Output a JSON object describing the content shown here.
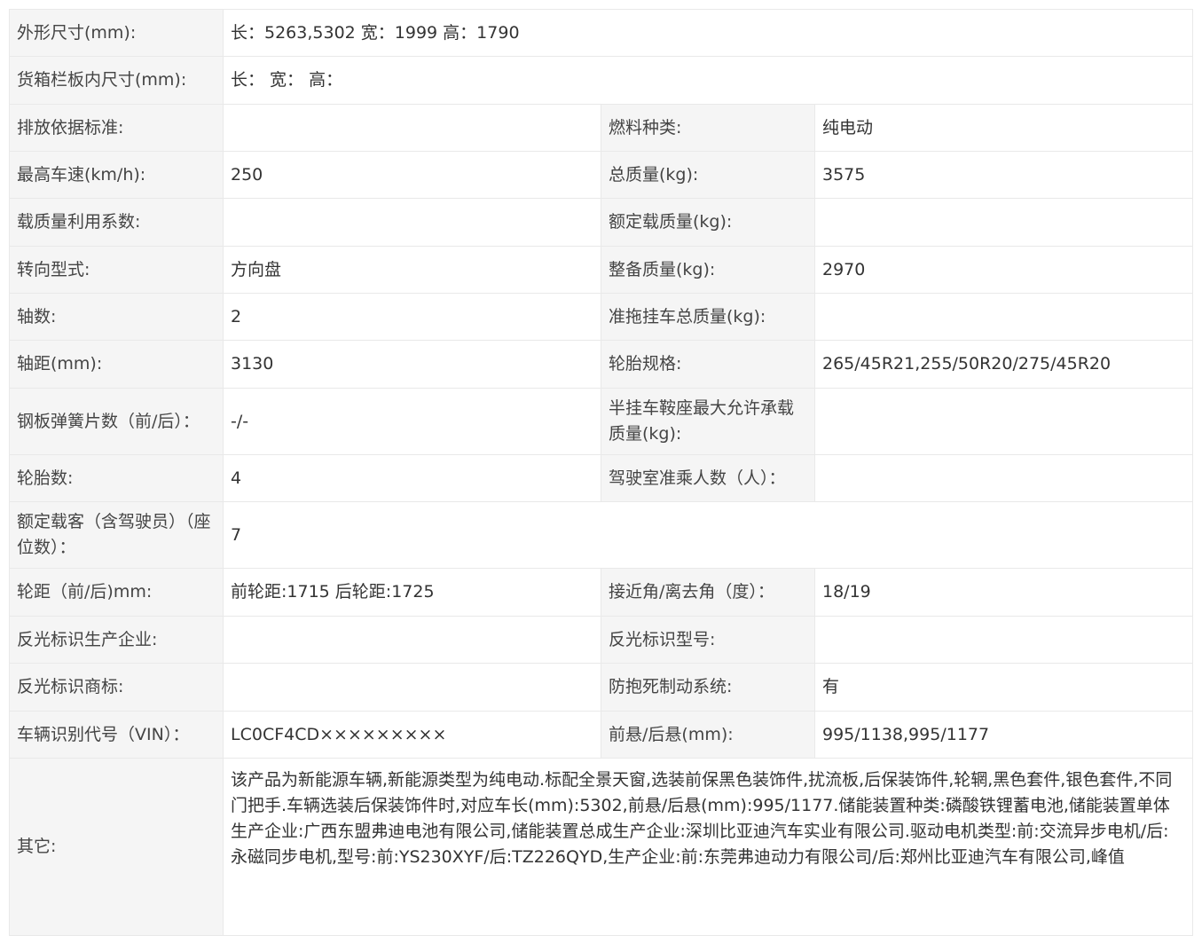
{
  "rows": {
    "dimensions": {
      "label": "外形尺寸(mm):",
      "value": "长：5263,5302 宽：1999 高：1790"
    },
    "cargo_box": {
      "label": "货箱栏板内尺寸(mm):",
      "value": "长：  宽：  高："
    },
    "emission": {
      "label": "排放依据标准:",
      "value": "",
      "label2": "燃料种类:",
      "value2": "纯电动"
    },
    "top_speed": {
      "label": "最高车速(km/h):",
      "value": "250",
      "label2": "总质量(kg):",
      "value2": "3575"
    },
    "load_factor": {
      "label": "载质量利用系数:",
      "value": "",
      "label2": "额定载质量(kg):",
      "value2": ""
    },
    "steering": {
      "label": "转向型式:",
      "value": "方向盘",
      "label2": "整备质量(kg):",
      "value2": "2970"
    },
    "axles": {
      "label": "轴数:",
      "value": "2",
      "label2": "准拖挂车总质量(kg):",
      "value2": ""
    },
    "wheelbase": {
      "label": "轴距(mm):",
      "value": "3130",
      "label2": "轮胎规格:",
      "value2": "265/45R21,255/50R20/275/45R20"
    },
    "leaf_springs": {
      "label": "钢板弹簧片数（前/后）：",
      "value": "-/-",
      "label2": "半挂车鞍座最大允许承载质量(kg):",
      "value2": ""
    },
    "tire_count": {
      "label": "轮胎数:",
      "value": "4",
      "label2": "驾驶室准乘人数（人）：",
      "value2": ""
    },
    "passengers": {
      "label": "额定载客（含驾驶员）（座位数）：",
      "value": "7"
    },
    "track": {
      "label": "轮距（前/后)mm:",
      "value": "前轮距:1715 后轮距:1725",
      "label2": "接近角/离去角（度）：",
      "value2": "18/19"
    },
    "reflector_maker": {
      "label": "反光标识生产企业:",
      "value": "",
      "label2": "反光标识型号:",
      "value2": ""
    },
    "reflector_brand": {
      "label": "反光标识商标:",
      "value": "",
      "label2": "防抱死制动系统:",
      "value2": "有"
    },
    "vin": {
      "label": "车辆识别代号（VIN）：",
      "value": "LC0CF4CD×××××××××",
      "label2": "前悬/后悬(mm):",
      "value2": "995/1138,995/1177"
    },
    "other": {
      "label": "其它:",
      "value": "该产品为新能源车辆,新能源类型为纯电动.标配全景天窗,选装前保黑色装饰件,扰流板,后保装饰件,轮辋,黑色套件,银色套件,不同门把手.车辆选装后保装饰件时,对应车长(mm):5302,前悬/后悬(mm):995/1177.储能装置种类:磷酸铁锂蓄电池,储能装置单体生产企业:广西东盟弗迪电池有限公司,储能装置总成生产企业:深圳比亚迪汽车实业有限公司.驱动电机类型:前:交流异步电机/后:永磁同步电机,型号:前:YS230XYF/后:TZ226QYD,生产企业:前:东莞弗迪动力有限公司/后:郑州比亚迪汽车有限公司,峰值"
    }
  }
}
